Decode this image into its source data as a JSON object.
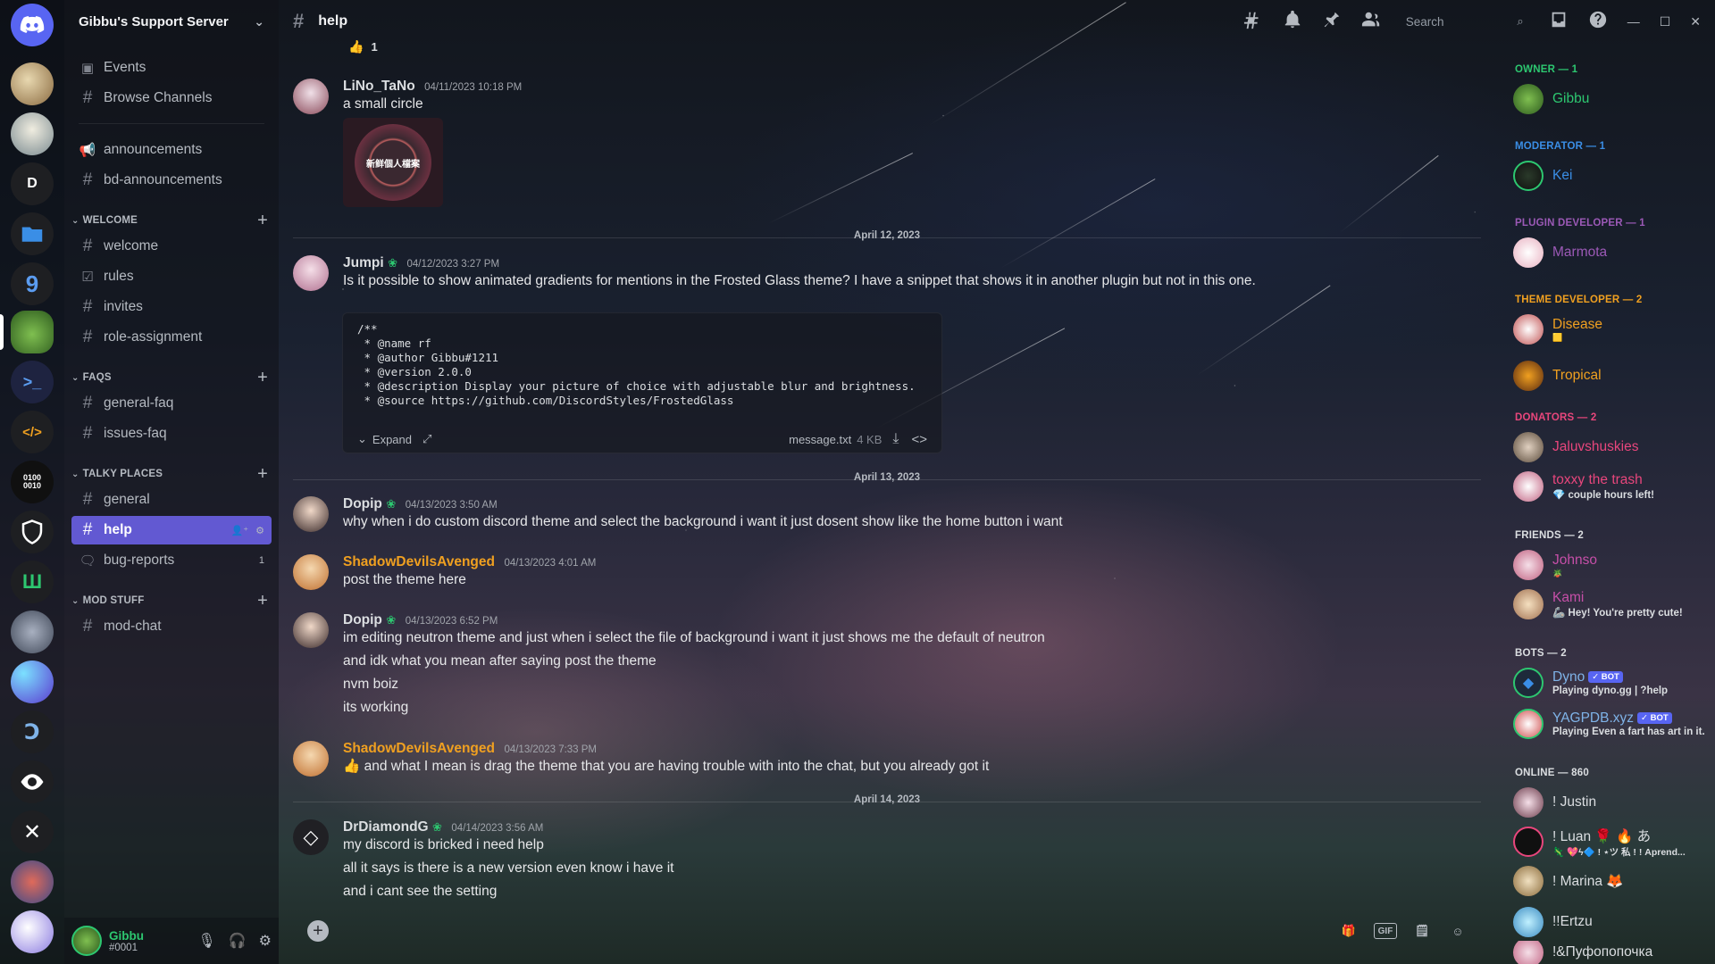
{
  "server": {
    "name": "Gibbu's Support Server",
    "rail_letter": "D"
  },
  "sidebar": {
    "top_items": [
      {
        "label": "Events",
        "icon": "calendar-icon"
      },
      {
        "label": "Browse Channels",
        "icon": "browse-channels-icon"
      }
    ],
    "announcements": [
      {
        "label": "announcements",
        "icon": "megaphone-icon"
      },
      {
        "label": "bd-announcements",
        "icon": "hash-icon"
      }
    ],
    "categories": [
      {
        "name": "WELCOME",
        "channels": [
          {
            "label": "welcome",
            "icon": "hash-icon"
          },
          {
            "label": "rules",
            "icon": "rules-check-icon"
          },
          {
            "label": "invites",
            "icon": "hash-icon"
          },
          {
            "label": "role-assignment",
            "icon": "hash-icon"
          }
        ]
      },
      {
        "name": "FAQS",
        "channels": [
          {
            "label": "general-faq",
            "icon": "hash-icon"
          },
          {
            "label": "issues-faq",
            "icon": "hash-icon"
          }
        ]
      },
      {
        "name": "TALKY PLACES",
        "channels": [
          {
            "label": "general",
            "icon": "hash-icon"
          },
          {
            "label": "help",
            "icon": "hash-icon",
            "active": true
          },
          {
            "label": "bug-reports",
            "icon": "forum-icon",
            "count": "1"
          }
        ]
      },
      {
        "name": "MOD STUFF",
        "channels": [
          {
            "label": "mod-chat",
            "icon": "hash-icon"
          }
        ]
      }
    ],
    "user": {
      "name": "Gibbu",
      "tag": "#0001"
    }
  },
  "topbar": {
    "channel": "help",
    "search_placeholder": "Search"
  },
  "chat": {
    "reaction": {
      "emoji": "👍",
      "count": "1"
    },
    "dividers": [
      "April 12, 2023",
      "April 13, 2023",
      "April 14, 2023"
    ],
    "messages": [
      {
        "author": "LiNo_TaNo",
        "timestamp": "04/11/2023 10:18 PM",
        "color": "#dbdee1",
        "lines": [
          "a small circle"
        ],
        "attachment_text": "新鲜個人檔案"
      },
      {
        "author": "Jumpi",
        "timestamp": "04/12/2023 3:27 PM",
        "color": "#dbdee1",
        "lines": [
          "Is it possible to show animated gradients for mentions in the Frosted Glass theme? I have a snippet that shows it in another plugin but not in this one."
        ]
      },
      {
        "author": "Dopip",
        "timestamp": "04/13/2023 3:50 AM",
        "color": "#dbdee1",
        "lines": [
          "why when i do custom discord theme and select the background i want it just dosent show like the home button i want"
        ]
      },
      {
        "author": "ShadowDevilsAvenged",
        "timestamp": "04/13/2023 4:01 AM",
        "color": "#f0a020",
        "lines": [
          "post the theme here"
        ]
      },
      {
        "author": "Dopip",
        "timestamp": "04/13/2023 6:52 PM",
        "color": "#dbdee1",
        "lines": [
          "im editing neutron theme and just when i select the file of background i want it just shows me the default of neutron",
          "and idk what you mean after saying post the theme",
          "nvm boiz",
          "its working"
        ]
      },
      {
        "author": "ShadowDevilsAvenged",
        "timestamp": "04/13/2023 7:33 PM",
        "color": "#f0a020",
        "lines": [
          "and what I mean is drag the theme that you are having trouble with into the chat, but you already got it"
        ]
      },
      {
        "author": "DrDiamondG",
        "timestamp": "04/14/2023 3:56 AM",
        "color": "#dbdee1",
        "lines": [
          "my discord is bricked i need help",
          "all it says is there is a new version even know i have it",
          "and i cant see the setting"
        ]
      }
    ],
    "code": {
      "lines": [
        "/**",
        " * @name rf",
        " * @author Gibbu#1211",
        " * @version 2.0.0",
        " * @description Display your picture of choice with adjustable blur and brightness.",
        " * @source https://github.com/DiscordStyles/FrostedGlass"
      ],
      "expand_label": "Expand",
      "filename": "message.txt",
      "filesize": "4 KB"
    }
  },
  "composer": {
    "gif_label": "GIF"
  },
  "members": {
    "groups": [
      {
        "title": "OWNER — 1",
        "color": "#2dc770",
        "members": [
          {
            "name": "Gibbu",
            "color": "#2dc770"
          }
        ]
      },
      {
        "title": "MODERATOR — 1",
        "color": "#3a8ee6",
        "members": [
          {
            "name": "Kei",
            "color": "#3a8ee6"
          }
        ]
      },
      {
        "title": "PLUGIN DEVELOPER — 1",
        "color": "#9b59b6",
        "members": [
          {
            "name": "Marmota",
            "color": "#9b59b6"
          }
        ]
      },
      {
        "title": "THEME DEVELOPER — 2",
        "color": "#f0a020",
        "members": [
          {
            "name": "Disease",
            "color": "#f0a020",
            "status": "🟨"
          },
          {
            "name": "Tropical",
            "color": "#f0a020"
          }
        ]
      },
      {
        "title": "DONATORS — 2",
        "color": "#e8467c",
        "members": [
          {
            "name": "Jaluvshuskies",
            "color": "#e8467c"
          },
          {
            "name": "toxxy the trash",
            "color": "#e8467c",
            "status": "💎 couple hours left!"
          }
        ]
      },
      {
        "title": "FRIENDS — 2",
        "color": "#dbdee1",
        "members": [
          {
            "name": "Johnso",
            "color": "#c64fa8",
            "status": "🪴"
          },
          {
            "name": "Kami",
            "color": "#c64fa8",
            "status": "🦾 Hey! You're pretty cute!"
          }
        ]
      },
      {
        "title": "BOTS — 2",
        "color": "#dbdee1",
        "members": [
          {
            "name": "Dyno",
            "color": "#7fb3e8",
            "bot": "✓ BOT",
            "status": "Playing dyno.gg | ?help"
          },
          {
            "name": "YAGPDB.xyz",
            "color": "#7fb3e8",
            "bot": "✓ BOT",
            "status": "Playing Even a fart has art in it."
          }
        ]
      },
      {
        "title": "ONLINE — 860",
        "color": "#dbdee1",
        "members": [
          {
            "name": "! Justin",
            "color": "#dbdee1"
          },
          {
            "name": "! Luan 🌹 🔥 あ",
            "color": "#dbdee1",
            "status": "🦎 💖ϟ🔷 ! ⋆ツ 私 ! ! Aprend..."
          },
          {
            "name": "! Marina 🦊",
            "color": "#dbdee1"
          },
          {
            "name": "!!Ertzu",
            "color": "#dbdee1"
          },
          {
            "name": "!&Пуфопопочка",
            "color": "#dbdee1"
          }
        ]
      }
    ]
  }
}
